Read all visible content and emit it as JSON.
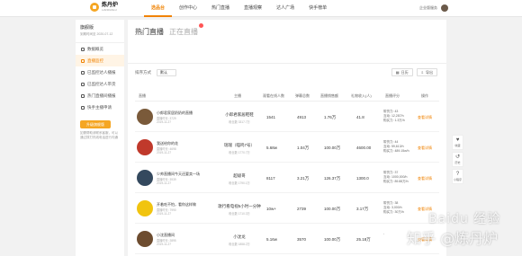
{
  "header": {
    "logo_title": "炼丹炉",
    "logo_sub": "LIANDANLU",
    "nav": [
      "选品台",
      "创作中心",
      "热门直播",
      "直播观察",
      "达人广场",
      "快手榜单"
    ],
    "active_nav": 0,
    "right_link": "企业版服务"
  },
  "sidebar": {
    "user_name": "旗舰版",
    "user_sub": "到期时间至 2020-07-12",
    "items": [
      "数据概览",
      "直播监控",
      "已监控达人播报",
      "已监控达人带货",
      "热门直播间播报",
      "快手主播申请"
    ],
    "active_index": 1,
    "button": "升级旗舰版",
    "note": "如需帮助请联系客服，可以通过拨打热线电话进行沟通"
  },
  "main": {
    "title": "热门直播",
    "title2": "正在直播",
    "filter_label": "排序方式",
    "filter_value": "默认",
    "tool_date": "日历",
    "tool_export": "导出",
    "columns": [
      "直播",
      "主播",
      "观看在线人数",
      "弹幕总数",
      "直播销售额",
      "礼物收入(人)",
      "直播评分",
      "操作"
    ],
    "rows": [
      {
        "title": "小郎君家居奶奶的直播",
        "meta1": "直播时长: 3729",
        "meta2": "2019-11-27",
        "anchor": "小郎君家居鞋鞋",
        "anchor_sub": "粉丝数 3317.7万",
        "viewers": "1541",
        "danmu": "4913",
        "sales": "1.76万",
        "gift": "41.8",
        "grade": [
          "带货力: 43",
          "互动: 12,287/h",
          "购买力: 1.3万/h"
        ],
        "action": "查看详情",
        "thumb": "#7a5a3a"
      },
      {
        "title": "我送给你的花",
        "meta1": "直播时长: 4698",
        "meta2": "2019-11-27",
        "anchor": "瑞瑞（喵鸣7号）",
        "anchor_sub": "粉丝数 1770.7万",
        "viewers": "5.68w",
        "danmu": "1.04万",
        "sales": "100.00万",
        "gift": "4600.00",
        "grade": [
          "带货力: 44",
          "互动: 59,613/h",
          "购买力: 489.15w/h"
        ],
        "action": "查看详情",
        "thumb": "#c0392b"
      },
      {
        "title": "少帅直播间今天还要卖一场",
        "meta1": "直播时长: 3939",
        "meta2": "2019-11-27",
        "anchor": "超级哥",
        "anchor_sub": "粉丝数 1790.1万",
        "viewers": "8117",
        "danmu": "3.21万",
        "sales": "126.37万",
        "gift": "1300.0",
        "grade": [
          "带货力: 37",
          "互动: 1000,000/h",
          "购买力: 89.88万/h"
        ],
        "action": "查看详情",
        "thumb": "#34495e"
      },
      {
        "title": "开着吃不怕，看你这样做",
        "meta1": "直播时长: 7990",
        "meta2": "2019-11-27",
        "anchor": "歌行看电视5小时一分钟",
        "anchor_sub": "粉丝数 1710.3万",
        "viewers": "10w+",
        "danmu": "2739",
        "sales": "100.00万",
        "gift": "3.17万",
        "grade": [
          "带货力: 38",
          "互动: 3,000/h",
          "购买力: 30万/h"
        ],
        "action": "查看详情",
        "thumb": "#f1c40f"
      },
      {
        "title": "小沈直播间",
        "meta1": "直播时长: 2895",
        "meta2": "2019-11-27",
        "anchor": "小沈龙",
        "anchor_sub": "粉丝数 1858.2万",
        "viewers": "5.16w",
        "danmu": "3570",
        "sales": "100.00万",
        "gift": "25.18万",
        "grade": [
          "-"
        ],
        "action": "查看详情",
        "thumb": "#6d4c2f"
      }
    ]
  },
  "right_toolbar": [
    {
      "icon": "heart-icon",
      "glyph": "♥",
      "label": "收藏"
    },
    {
      "icon": "history-icon",
      "glyph": "↺",
      "label": "历史"
    },
    {
      "icon": "help-icon",
      "glyph": "?",
      "label": "小程序"
    }
  ],
  "watermark": {
    "line1": "Baidu 经验",
    "line2": "知乎 @炼丹炉"
  }
}
